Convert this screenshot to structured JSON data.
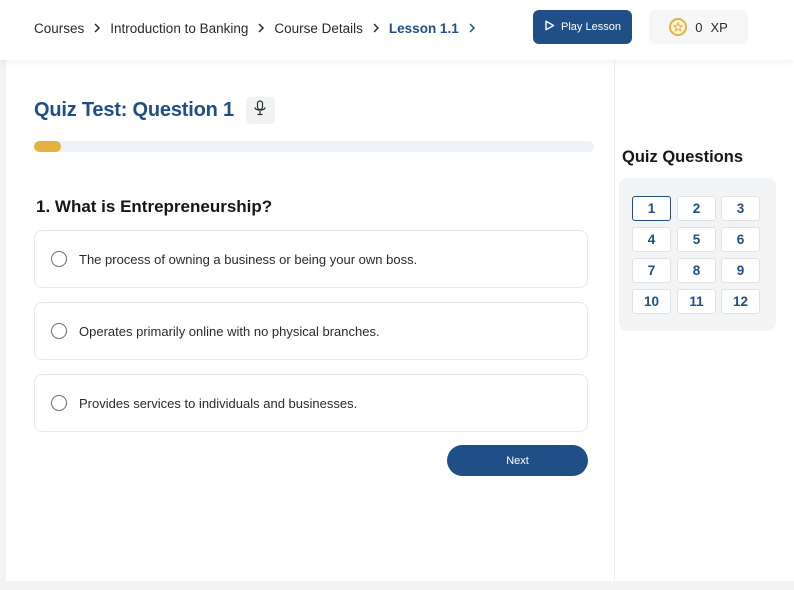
{
  "header": {
    "breadcrumb": [
      {
        "label": "Courses",
        "active": false
      },
      {
        "label": "Introduction to Banking",
        "active": false
      },
      {
        "label": "Course Details",
        "active": false
      },
      {
        "label": "Lesson 1.1",
        "active": true
      }
    ],
    "play_label": "Play Lesson",
    "xp_value": "0",
    "xp_unit": "XP"
  },
  "quiz": {
    "title": "Quiz Test: Question 1",
    "progress": 0.048,
    "question": "1. What is Entrepreneurship?",
    "options": [
      "The process of owning a business or being your own boss.",
      "Operates primarily online with no physical branches.",
      "Provides services to individuals and businesses."
    ],
    "next_label": "Next"
  },
  "sidebar": {
    "title": "Quiz Questions",
    "current": "1",
    "questions": [
      "1",
      "2",
      "3",
      "4",
      "5",
      "6",
      "7",
      "8",
      "9",
      "10",
      "11",
      "12"
    ]
  },
  "colors": {
    "accent": "#1f4f86",
    "progress": "#e3b33f"
  },
  "icons": {
    "breadcrumb_separator": "chevron-right-icon",
    "play": "play-icon",
    "xp": "star-coin-icon",
    "mic": "microphone-icon"
  }
}
